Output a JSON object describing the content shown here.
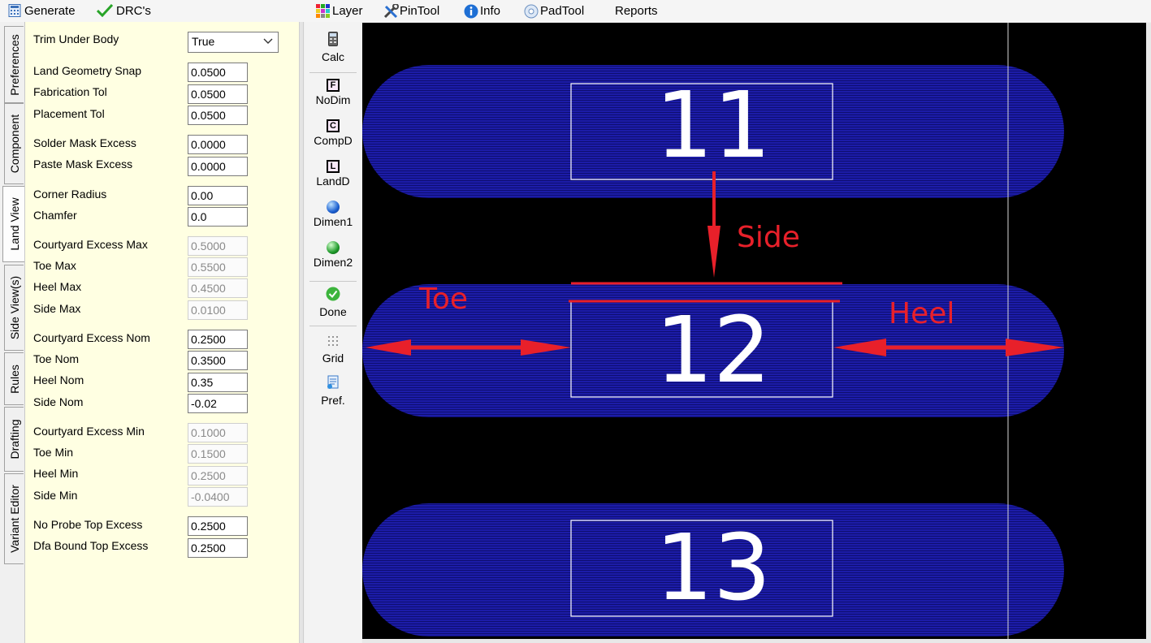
{
  "toolbar": {
    "generate": "Generate",
    "drcs": "DRC's",
    "layer": "Layer",
    "pintool": "PinTool",
    "info": "Info",
    "padtool": "PadTool",
    "reports": "Reports"
  },
  "tabs": [
    "Preferences",
    "Component",
    "Land View",
    "Side View(s)",
    "Rules",
    "Drafting",
    "Variant Editor"
  ],
  "active_tab": "Land View",
  "properties": {
    "trim_under_body": {
      "label": "Trim Under Body",
      "value": "True"
    },
    "land_geometry_snap": {
      "label": "Land Geometry Snap",
      "value": "0.0500"
    },
    "fabrication_tol": {
      "label": "Fabrication Tol",
      "value": "0.0500"
    },
    "placement_tol": {
      "label": "Placement Tol",
      "value": "0.0500"
    },
    "solder_mask_excess": {
      "label": "Solder Mask Excess",
      "value": "0.0000"
    },
    "paste_mask_excess": {
      "label": "Paste Mask Excess",
      "value": "0.0000"
    },
    "corner_radius": {
      "label": "Corner Radius",
      "value": "0.00"
    },
    "chamfer": {
      "label": "Chamfer",
      "value": "0.0"
    },
    "courtyard_excess_max": {
      "label": "Courtyard Excess Max",
      "value": "0.5000"
    },
    "toe_max": {
      "label": "Toe Max",
      "value": "0.5500"
    },
    "heel_max": {
      "label": "Heel Max",
      "value": "0.4500"
    },
    "side_max": {
      "label": "Side Max",
      "value": "0.0100"
    },
    "courtyard_excess_nom": {
      "label": "Courtyard Excess Nom",
      "value": "0.2500"
    },
    "toe_nom": {
      "label": "Toe Nom",
      "value": "0.3500"
    },
    "heel_nom": {
      "label": "Heel Nom",
      "value": "0.35"
    },
    "side_nom": {
      "label": "Side Nom",
      "value": "-0.02"
    },
    "courtyard_excess_min": {
      "label": "Courtyard Excess Min",
      "value": "0.1000"
    },
    "toe_min": {
      "label": "Toe Min",
      "value": "0.1500"
    },
    "heel_min": {
      "label": "Heel Min",
      "value": "0.2500"
    },
    "side_min": {
      "label": "Side Min",
      "value": "-0.0400"
    },
    "no_probe_top_excess": {
      "label": "No Probe Top Excess",
      "value": "0.2500"
    },
    "dfa_bound_top_excess": {
      "label": "Dfa Bound Top Excess",
      "value": "0.2500"
    }
  },
  "tools": {
    "calc": "Calc",
    "nodim": "NoDim",
    "compd": "CompD",
    "landd": "LandD",
    "dimen1": "Dimen1",
    "dimen2": "Dimen2",
    "done": "Done",
    "grid": "Grid",
    "pref": "Pref.",
    "nodim_letter": "F",
    "compd_letter": "C",
    "landd_letter": "L"
  },
  "canvas": {
    "pads": [
      "11",
      "12",
      "13"
    ],
    "annotations": {
      "side": "Side",
      "toe": "Toe",
      "heel": "Heel"
    },
    "colors": {
      "pad": "#1a1aa0",
      "annotation": "#e8202a",
      "background": "#000000",
      "outline": "#ffffff"
    }
  }
}
